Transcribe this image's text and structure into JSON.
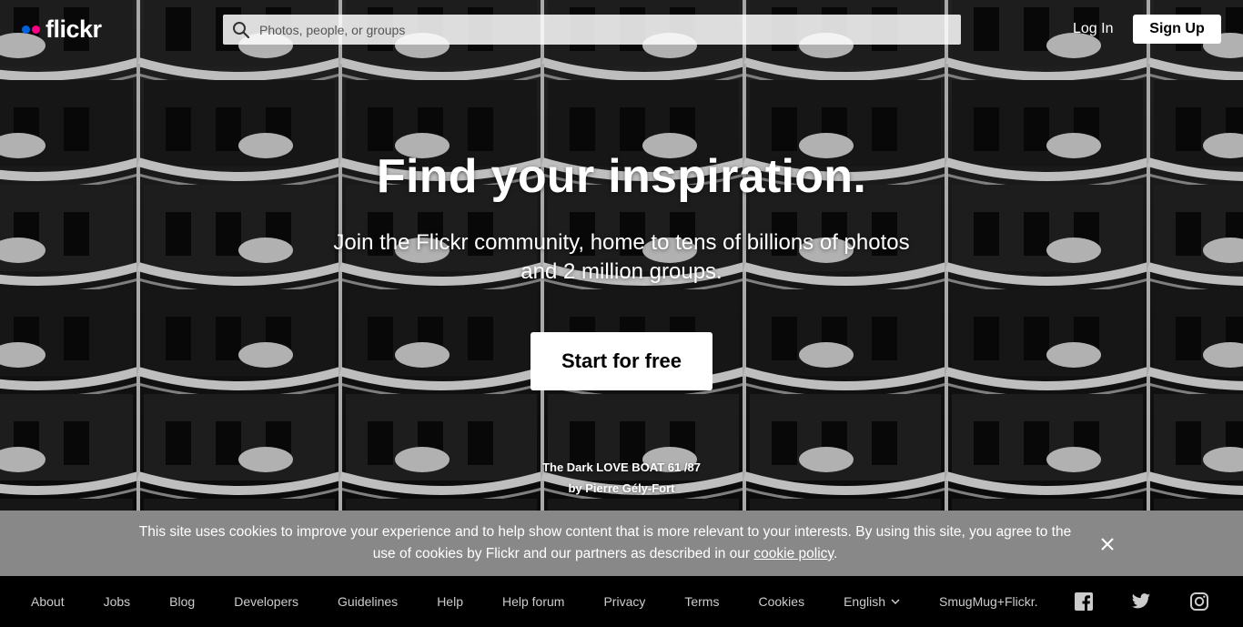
{
  "header": {
    "logo_text": "flickr",
    "brand_colors": {
      "blue": "#0063dc",
      "pink": "#ff0084"
    },
    "search_placeholder": "Photos, people, or groups",
    "login_label": "Log In",
    "signup_label": "Sign Up"
  },
  "hero": {
    "headline": "Find your inspiration.",
    "subline": "Join the Flickr community, home to tens of billions of photos and 2 million groups.",
    "cta_label": "Start for free",
    "photo_title": "The Dark LOVE BOAT 61 /87",
    "photo_author": "by Pierre Gély-Fort"
  },
  "cookie_banner": {
    "text_before_link": "This site uses cookies to improve your experience and to help show content that is more relevant to your interests. By using this site, you agree to the use of cookies by Flickr and our partners as described in our ",
    "link_text": "cookie policy",
    "text_after_link": ".",
    "close_icon": "close-icon"
  },
  "footer": {
    "links": [
      "About",
      "Jobs",
      "Blog",
      "Developers",
      "Guidelines",
      "Help",
      "Help forum",
      "Privacy",
      "Terms",
      "Cookies"
    ],
    "language": "English",
    "smugmug": "SmugMug+Flickr.",
    "social_icons": [
      "facebook-icon",
      "twitter-icon",
      "instagram-icon"
    ]
  }
}
